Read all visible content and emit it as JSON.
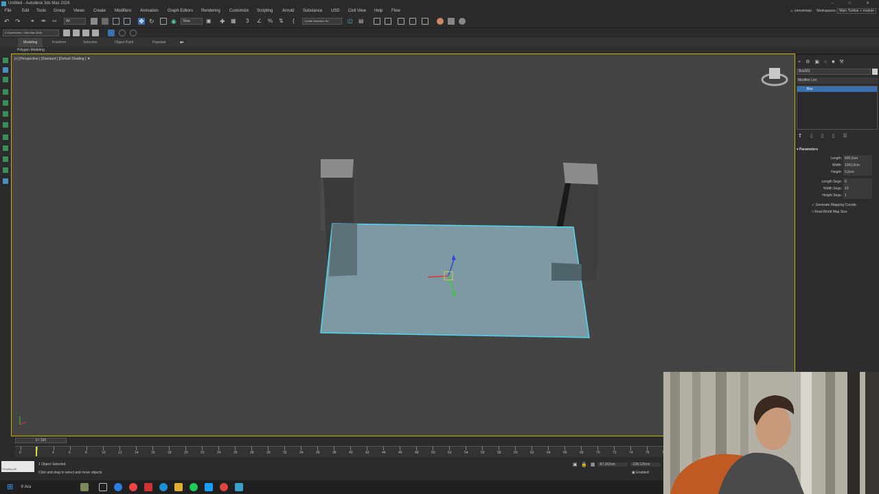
{
  "window": {
    "title": "Untitled - Autodesk 3ds Max 2026",
    "controls": "– □ ✕"
  },
  "menu": {
    "items": [
      "File",
      "Edit",
      "Tools",
      "Group",
      "Views",
      "Create",
      "Modifiers",
      "Animation",
      "Graph Editors",
      "Rendering",
      "Customize",
      "Scripting",
      "Arnold",
      "Substance",
      "USD",
      "Civil View",
      "Help",
      "Flow"
    ],
    "user": "cemsimsen",
    "workspaces_label": "Workspaces:",
    "workspace_value": "Main Toolbar + module"
  },
  "toolbar": {
    "selection_filter": "All",
    "ref_coord": "View",
    "named_selection": "Create Selection Se",
    "project_path": "C:\\Users\\cem...\\3ds Max 2026"
  },
  "ribbon": {
    "tabs": [
      "Modeling",
      "Freeform",
      "Selection",
      "Object Paint",
      "Populate"
    ],
    "active_tab": "Modeling",
    "sub_label": "Polygon Modeling"
  },
  "viewport": {
    "label": "[+] [Perspective ] [Standard ] [Default Shading ]",
    "filter_icon": "funnel-icon"
  },
  "command_panel": {
    "object_name": "Box001",
    "modifier_list_label": "Modifier List",
    "stack_item": "Box",
    "rollout_title": "Parameters",
    "params": [
      {
        "label": "Length:",
        "value": "600,0cm"
      },
      {
        "label": "Width:",
        "value": "1000,0cm"
      },
      {
        "label": "Height:",
        "value": "5,0cm"
      }
    ],
    "segs": [
      {
        "label": "Length Segs:",
        "value": "6"
      },
      {
        "label": "Width Segs:",
        "value": "10"
      },
      {
        "label": "Height Segs:",
        "value": "1"
      }
    ],
    "gen_map_label": "Generate Mapping Coords.",
    "realworld_label": "Real-World Map Size"
  },
  "timeline": {
    "slider_text": "0 / 100",
    "ticks": [
      "0",
      "2",
      "4",
      "6",
      "8",
      "10",
      "12",
      "14",
      "16",
      "18",
      "20",
      "22",
      "24",
      "26",
      "28",
      "30",
      "32",
      "34",
      "36",
      "38",
      "40",
      "42",
      "44",
      "46",
      "48",
      "50",
      "52",
      "54",
      "56",
      "58",
      "60",
      "62",
      "64",
      "66",
      "68",
      "70",
      "72",
      "74",
      "76",
      "78"
    ]
  },
  "status": {
    "script_label": "Scripting Mi",
    "selected": "1 Object Selected",
    "prompt": "Click and drag to select and move objects",
    "x_value": "-97,262cm",
    "y_value": "-228,126cm",
    "enabled_label": "Enabled:"
  },
  "taskbar": {
    "search_label": "Ara"
  },
  "colors": {
    "selection_cyan": "#4fd6ef",
    "viewport_bg": "#444444",
    "active_blue": "#3a6fb0"
  }
}
